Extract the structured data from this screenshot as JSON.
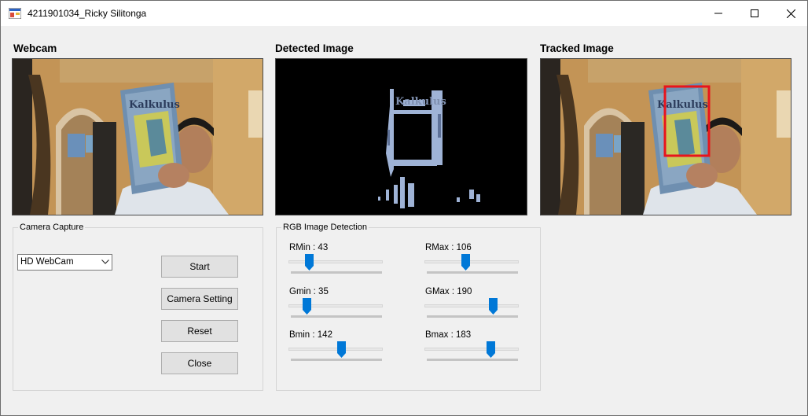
{
  "window": {
    "title": "4211901034_Ricky Silitonga",
    "icon": "app-window-icon",
    "controls": [
      "minimize-icon",
      "maximize-icon",
      "close-icon"
    ]
  },
  "panels": {
    "webcam_title": "Webcam",
    "detected_title": "Detected Image",
    "tracked_title": "Tracked Image",
    "book_text": "Kalkulus"
  },
  "camera_capture": {
    "group_label": "Camera Capture",
    "device_selected": "HD WebCam",
    "buttons": {
      "start": "Start",
      "camera_setting": "Camera Setting",
      "reset": "Reset",
      "close": "Close"
    }
  },
  "rgb_detection": {
    "group_label": "RGB Image Detection",
    "sliders": [
      {
        "label": "RMin : 43",
        "value": 43,
        "max": 255
      },
      {
        "label": "RMax : 106",
        "value": 106,
        "max": 255
      },
      {
        "label": "Gmin : 35",
        "value": 35,
        "max": 255
      },
      {
        "label": "GMax : 190",
        "value": 190,
        "max": 255
      },
      {
        "label": "Bmin : 142",
        "value": 142,
        "max": 255
      },
      {
        "label": "Bmax : 183",
        "value": 183,
        "max": 255
      }
    ]
  },
  "colors": {
    "accent_blue": "#0078d7",
    "tracking_box": "#e8141c",
    "window_bg": "#f0f0f0"
  }
}
